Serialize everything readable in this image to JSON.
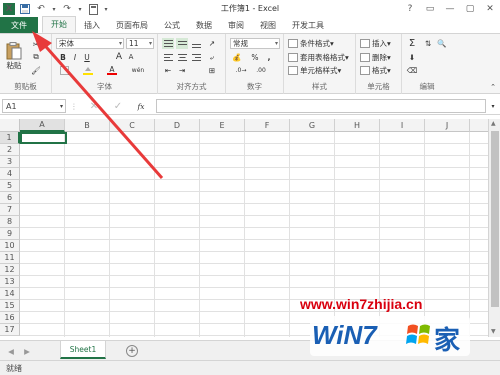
{
  "window": {
    "title": "工作簿1 - Excel",
    "controls": [
      "?",
      "▭",
      "—",
      "▢",
      "✕"
    ]
  },
  "qat": {
    "logo": "X",
    "save_icon": "💾",
    "undo": "↶",
    "redo": "↷"
  },
  "tabs": [
    {
      "label": "文件",
      "kind": "file"
    },
    {
      "label": "开始",
      "kind": "active"
    },
    {
      "label": "插入"
    },
    {
      "label": "页面布局"
    },
    {
      "label": "公式"
    },
    {
      "label": "数据"
    },
    {
      "label": "审阅"
    },
    {
      "label": "视图"
    },
    {
      "label": "开发工具"
    }
  ],
  "ribbon": {
    "clipboard": {
      "label": "剪贴板",
      "paste": "粘贴"
    },
    "font": {
      "label": "字体",
      "font_name": "宋体",
      "font_size": "11",
      "bold": "B",
      "italic": "I",
      "underline": "U",
      "grow": "A",
      "shrink": "A",
      "color_a": "A",
      "wen": "wén"
    },
    "align": {
      "label": "对齐方式"
    },
    "number": {
      "label": "数字",
      "format": "常规",
      "percent": "%",
      "comma": ","
    },
    "styles": {
      "label": "样式",
      "cond": "条件格式",
      "table": "套用表格格式",
      "cell": "单元格样式"
    },
    "cells": {
      "label": "单元格",
      "insert": "插入",
      "delete": "删除",
      "format": "格式"
    },
    "edit": {
      "label": "编辑",
      "sum": "Σ"
    }
  },
  "formula_bar": {
    "namebox": "A1",
    "fx": "fx",
    "value": ""
  },
  "columns": [
    "A",
    "B",
    "C",
    "D",
    "E",
    "F",
    "G",
    "H",
    "I",
    "J"
  ],
  "rows": [
    "1",
    "2",
    "3",
    "4",
    "5",
    "6",
    "7",
    "8",
    "9",
    "10",
    "11",
    "12",
    "13",
    "14",
    "15",
    "16",
    "17"
  ],
  "sheets": [
    {
      "label": "Sheet1"
    }
  ],
  "status": {
    "text": "就绪"
  },
  "watermark": {
    "url": "www.win7zhijia.cn",
    "logo_left": "WiN7",
    "logo_right": "家"
  },
  "colors": {
    "accent": "#217346",
    "arrow": "#e83a3a",
    "watermark_red": "#d9000e",
    "watermark_blue": "#1a5fb4"
  }
}
